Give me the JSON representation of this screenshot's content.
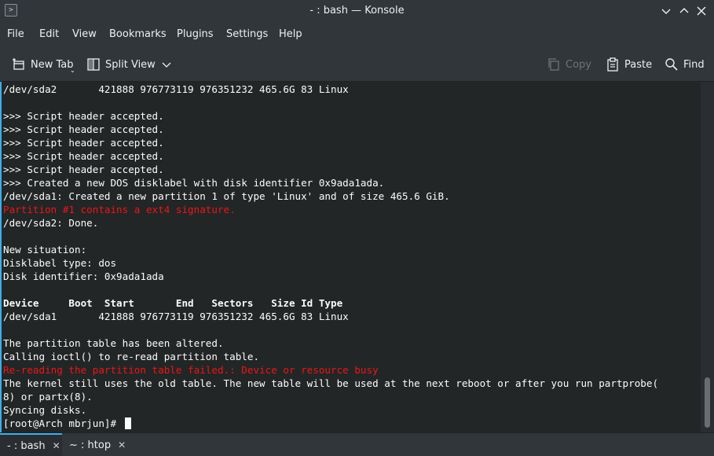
{
  "window": {
    "title": "- : bash — Konsole",
    "app_icon": "terminal-icon"
  },
  "menu": [
    "File",
    "Edit",
    "View",
    "Bookmarks",
    "Plugins",
    "Settings",
    "Help"
  ],
  "toolbar": {
    "new_tab": "New Tab",
    "split_view": "Split View",
    "copy": "Copy",
    "paste": "Paste",
    "find": "Find"
  },
  "terminal": {
    "lines": [
      {
        "text": "/dev/sda2       421888 976773119 976351232 465.6G 83 Linux",
        "style": "normal"
      },
      {
        "text": "",
        "style": "normal"
      },
      {
        "text": ">>> Script header accepted.",
        "style": "normal"
      },
      {
        "text": ">>> Script header accepted.",
        "style": "normal"
      },
      {
        "text": ">>> Script header accepted.",
        "style": "normal"
      },
      {
        "text": ">>> Script header accepted.",
        "style": "normal"
      },
      {
        "text": ">>> Script header accepted.",
        "style": "normal"
      },
      {
        "text": ">>> Created a new DOS disklabel with disk identifier 0x9ada1ada.",
        "style": "normal"
      },
      {
        "text": "/dev/sda1: Created a new partition 1 of type 'Linux' and of size 465.6 GiB.",
        "style": "normal"
      },
      {
        "text": "Partition #1 contains a ext4 signature.",
        "style": "err"
      },
      {
        "text": "/dev/sda2: Done.",
        "style": "normal"
      },
      {
        "text": "",
        "style": "normal"
      },
      {
        "text": "New situation:",
        "style": "normal"
      },
      {
        "text": "Disklabel type: dos",
        "style": "normal"
      },
      {
        "text": "Disk identifier: 0x9ada1ada",
        "style": "normal"
      },
      {
        "text": "",
        "style": "normal"
      },
      {
        "text": "Device     Boot  Start       End   Sectors   Size Id Type",
        "style": "bold"
      },
      {
        "text": "/dev/sda1       421888 976773119 976351232 465.6G 83 Linux",
        "style": "normal"
      },
      {
        "text": "",
        "style": "normal"
      },
      {
        "text": "The partition table has been altered.",
        "style": "normal"
      },
      {
        "text": "Calling ioctl() to re-read partition table.",
        "style": "normal"
      },
      {
        "text": "Re-reading the partition table failed.: Device or resource busy",
        "style": "err"
      },
      {
        "text": "The kernel still uses the old table. The new table will be used at the next reboot or after you run partprobe(",
        "style": "normal"
      },
      {
        "text": "8) or partx(8).",
        "style": "normal"
      },
      {
        "text": "Syncing disks.",
        "style": "normal"
      }
    ],
    "prompt": "[root@Arch mbrjun]# "
  },
  "tabs": [
    {
      "label": "- : bash",
      "active": true
    },
    {
      "label": "~ : htop",
      "active": false
    }
  ],
  "colors": {
    "accent": "#3daee9",
    "error_text": "#ed1515",
    "terminal_bg": "#232627",
    "chrome_bg": "#31363b"
  }
}
